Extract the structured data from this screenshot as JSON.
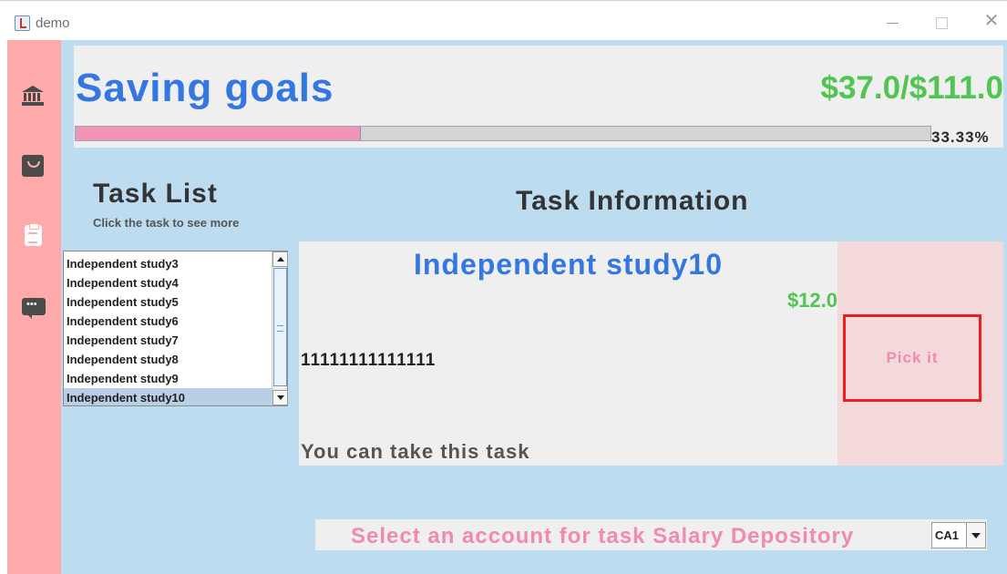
{
  "window": {
    "title": "demo"
  },
  "sidebar": {
    "items": [
      {
        "icon": "bank-icon"
      },
      {
        "icon": "shopping-bag-icon"
      },
      {
        "icon": "clipboard-icon"
      },
      {
        "icon": "chat-icon"
      }
    ]
  },
  "goal": {
    "title": "Saving goals",
    "amount": "$37.0/$111.0",
    "progress_fraction": 0.3333,
    "progress_text": "33.33%"
  },
  "task_list": {
    "title": "Task List",
    "hint": "Click the task to see more",
    "items": [
      "Independent study3",
      "Independent study4",
      "Independent study5",
      "Independent study6",
      "Independent study7",
      "Independent study8",
      "Independent study9",
      "Independent study10"
    ],
    "selected_index": 7
  },
  "task_info": {
    "title": "Task Information",
    "name": "Independent study10",
    "reward": "$12.0",
    "description": "11111111111111",
    "status": "You can take this task",
    "pick_label": "Pick it"
  },
  "account": {
    "prompt": "Select an account for task Salary Depository",
    "selected": "CA1"
  },
  "colors": {
    "accent_blue": "#3477e0",
    "money_green": "#52c451",
    "pink": "#f08ab0",
    "sidebar": "#ffaaaa",
    "background": "#bedcef"
  }
}
